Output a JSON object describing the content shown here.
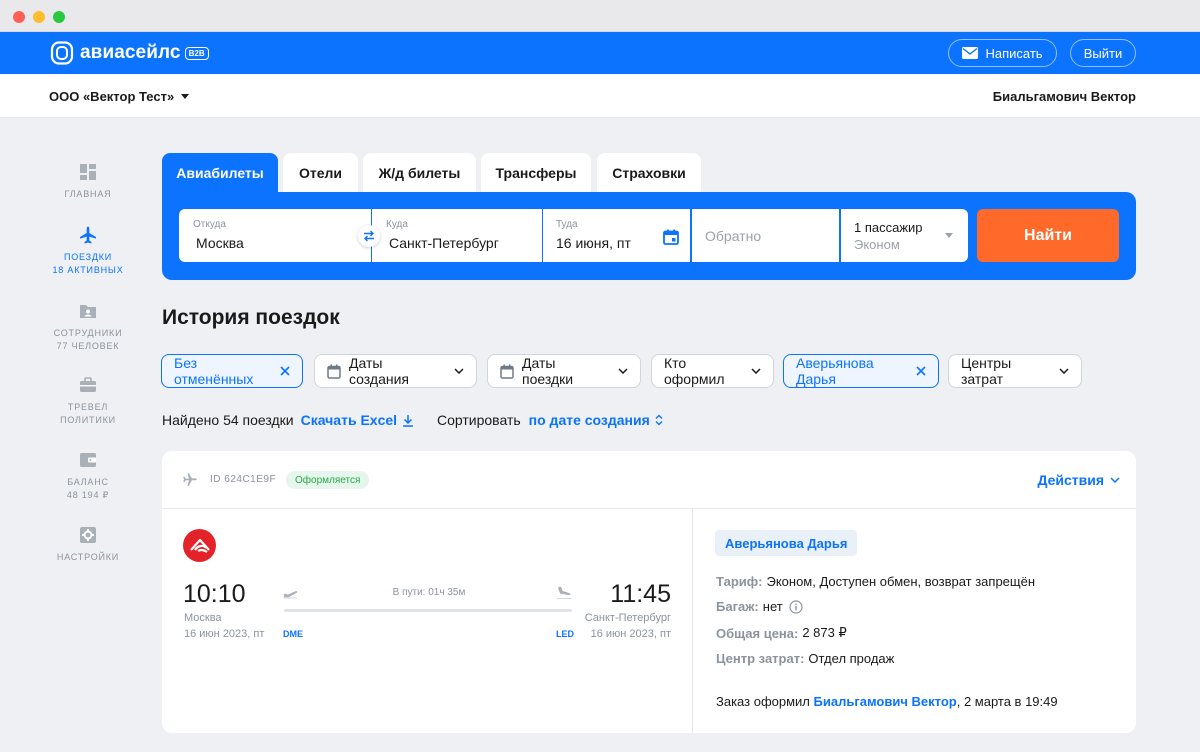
{
  "header": {
    "logo_text": "авиасейлс",
    "logo_badge": "B2B",
    "write_label": "Написать",
    "exit_label": "Выйти",
    "company": "ООО «Вектор Тест»",
    "user": "Биальгамович Вектор"
  },
  "sidebar": [
    {
      "label": "ГЛАВНАЯ",
      "sub": "",
      "icon": "dashboard-icon",
      "active": false
    },
    {
      "label": "ПОЕЗДКИ",
      "sub": "18 АКТИВНЫХ",
      "icon": "plane-icon",
      "active": true
    },
    {
      "label": "СОТРУДНИКИ",
      "sub": "77 ЧЕЛОВЕК",
      "icon": "employees-folder-icon",
      "active": false
    },
    {
      "label": "ТРЕВЕЛ",
      "sub": "ПОЛИТИКИ",
      "icon": "briefcase-icon",
      "active": false
    },
    {
      "label": "БАЛАНС",
      "sub": "48 194 ₽",
      "icon": "wallet-icon",
      "active": false
    },
    {
      "label": "НАСТРОЙКИ",
      "sub": "",
      "icon": "settings-icon",
      "active": false
    }
  ],
  "tabs": [
    "Авиабилеты",
    "Отели",
    "Ж/д билеты",
    "Трансферы",
    "Страховки"
  ],
  "search": {
    "from_caption": "Откуда",
    "from_value": "Москва",
    "to_caption": "Куда",
    "to_value": "Санкт-Петербург",
    "date_caption": "Туда",
    "date_value": "16 июня, пт",
    "back_placeholder": "Обратно",
    "passengers": "1 пассажир",
    "class": "Эконом",
    "find_label": "Найти"
  },
  "history": {
    "title": "История поездок",
    "filters": {
      "no_cancelled": "Без отменённых",
      "created_dates": "Даты создания",
      "trip_dates": "Даты поездки",
      "who_booked": "Кто оформил",
      "person": "Аверьянова Дарья",
      "cost_centers": "Центры затрат"
    },
    "found": "Найдено 54 поездки",
    "download": "Скачать Excel",
    "sort_label": "Сортировать",
    "sort_value": "по дате создания"
  },
  "trip": {
    "id": "ID 624C1E9F",
    "status": "Оформляется",
    "actions": "Действия",
    "dep_time": "10:10",
    "dep_city": "Москва",
    "dep_date": "16 июн 2023, пт",
    "dep_code": "DME",
    "arr_time": "11:45",
    "arr_city": "Санкт-Петербург",
    "arr_date": "16 июн 2023, пт",
    "arr_code": "LED",
    "duration": "В пути: 01ч 35м",
    "passenger": "Аверьянова Дарья",
    "tariff_label": "Тариф:",
    "tariff_value": "Эконом, Доступен обмен, возврат запрещён",
    "baggage_label": "Багаж:",
    "baggage_value": "нет",
    "price_label": "Общая цена:",
    "price_value": "2 873 ₽",
    "cost_center_label": "Центр затрат:",
    "cost_center_value": "Отдел продаж",
    "order_prefix": "Заказ оформил",
    "order_by": "Биальгамович Вектор",
    "order_suffix": ", 2 марта в 19:49"
  },
  "colors": {
    "brand_blue": "#0c73fe",
    "find_orange": "#ff6a2b",
    "status_green": "#2aa84a",
    "airline_red": "#e32329"
  }
}
